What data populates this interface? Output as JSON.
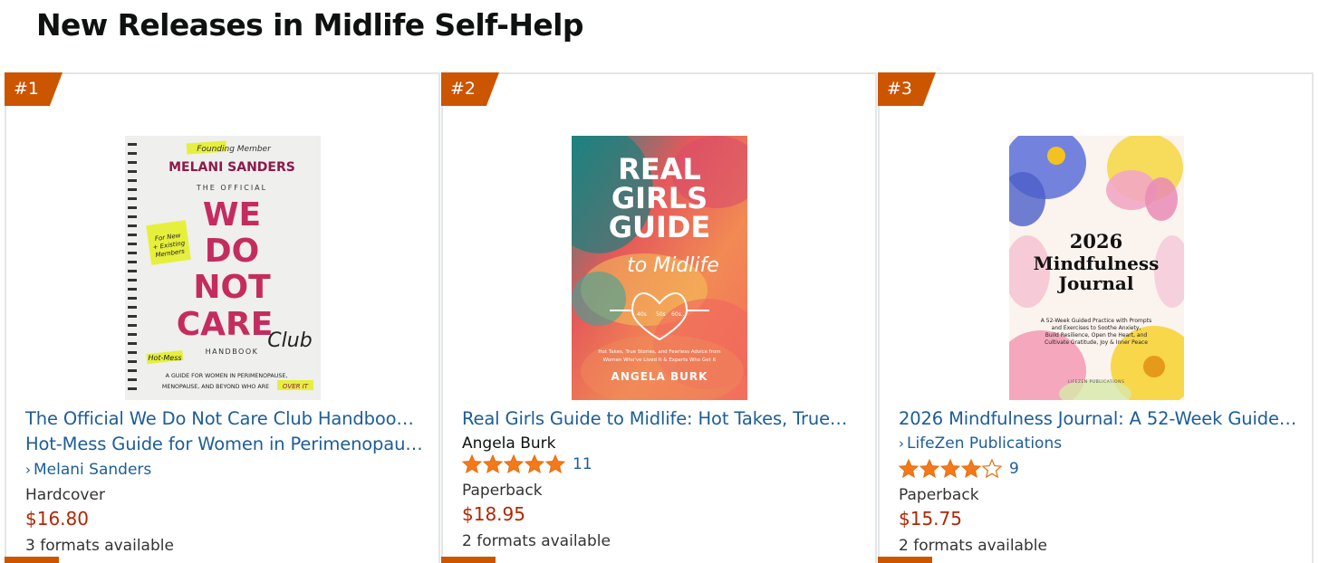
{
  "page": {
    "title": "New Releases in Midlife Self-Help"
  },
  "colors": {
    "rank_badge": "#cc5500",
    "link": "#1d5d99",
    "price": "#b12704",
    "star": "#f27a1a"
  },
  "products": [
    {
      "rank": "#1",
      "cover": {
        "badge_top": "Founding Member",
        "author": "MELANI SANDERS",
        "the_official": "THE OFFICIAL",
        "word1": "WE",
        "word2": "DO",
        "word3": "NOT",
        "word4": "CARE",
        "club": "Club",
        "handbook": "HANDBOOK",
        "side_note_1": "For New",
        "side_note_2": "+ Existing",
        "side_note_3": "Members",
        "hot_mess": "Hot-Mess",
        "subtitle_1": "A GUIDE FOR WOMEN IN PERIMENOPAUSE,",
        "subtitle_2": "MENOPAUSE, AND BEYOND WHO ARE",
        "over_it": "OVER IT"
      },
      "title_line1": "The Official We Do Not Care Club Handbook: A",
      "title_line2": "Hot-Mess Guide for Women in Perimenopaus…",
      "author": "Melani Sanders",
      "format": "Hardcover",
      "price": "$16.80",
      "formats_available": "3 formats available"
    },
    {
      "rank": "#2",
      "cover": {
        "t1": "REAL",
        "t2": "GIRLS",
        "t3": "GUIDE",
        "t4": "to Midlife",
        "ages_1": "40s",
        "ages_2": "50s",
        "ages_3": "60s...",
        "blurb_1": "Hot Takes, True Stories, and Fearless Advice from",
        "blurb_2": "Women Who've Lived It & Experts Who Get It",
        "author": "ANGELA BURK"
      },
      "title_line1": "Real Girls Guide to Midlife: Hot Takes, True…",
      "author": "Angela Burk",
      "rating_value": 5,
      "rating_count": "11",
      "format": "Paperback",
      "price": "$18.95",
      "formats_available": "2 formats available"
    },
    {
      "rank": "#3",
      "cover": {
        "year": "2026",
        "t1": "Mindfulness",
        "t2": "Journal",
        "blurb_1": "A 52-Week Guided Practice with Prompts",
        "blurb_2": "and Exercises to Soothe Anxiety,",
        "blurb_3": "Build Resilience, Open the Heart, and",
        "blurb_4": "Cultivate Gratitude, Joy & Inner Peace",
        "publisher": "LIFEZEN PUBLICATIONS"
      },
      "title_line1": "2026 Mindfulness Journal: A 52-Week Guide…",
      "author": "LifeZen Publications",
      "rating_value": 4.5,
      "rating_count": "9",
      "format": "Paperback",
      "price": "$15.75",
      "formats_available": "2 formats available"
    }
  ]
}
